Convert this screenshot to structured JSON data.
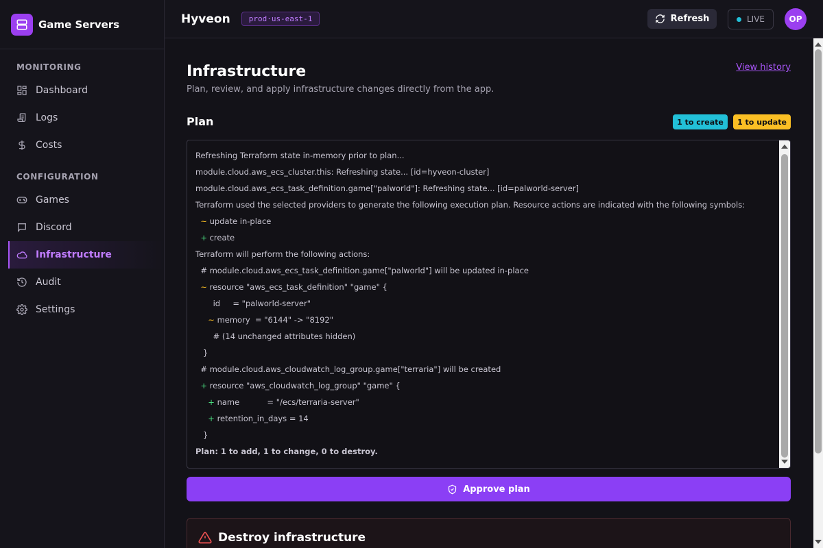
{
  "app": {
    "title": "Game Servers"
  },
  "sidebar": {
    "sections": [
      {
        "label": "MONITORING"
      },
      {
        "label": "CONFIGURATION"
      }
    ],
    "items": [
      {
        "label": "Dashboard",
        "icon": "dashboard-icon"
      },
      {
        "label": "Logs",
        "icon": "logs-icon"
      },
      {
        "label": "Costs",
        "icon": "dollar-icon"
      },
      {
        "label": "Games",
        "icon": "gamepad-icon"
      },
      {
        "label": "Discord",
        "icon": "chat-icon"
      },
      {
        "label": "Infrastructure",
        "icon": "cloud-icon",
        "active": true
      },
      {
        "label": "Audit",
        "icon": "history-icon"
      },
      {
        "label": "Settings",
        "icon": "gear-icon"
      }
    ]
  },
  "header": {
    "org": "Hyveon",
    "environment": "prod·us-east-1",
    "refresh_label": "Refresh",
    "live_label": "LIVE",
    "avatar_initials": "OP"
  },
  "page": {
    "title": "Infrastructure",
    "subtitle": "Plan, review, and apply infrastructure changes directly from the app.",
    "view_history": "View history"
  },
  "plan": {
    "title": "Plan",
    "badge_create": "1 to create",
    "badge_update": "1 to update",
    "lines": [
      {
        "sym": "",
        "text": "Refreshing Terraform state in-memory prior to plan..."
      },
      {
        "sym": "",
        "text": "module.cloud.aws_ecs_cluster.this: Refreshing state... [id=hyveon-cluster]"
      },
      {
        "sym": "",
        "text": "module.cloud.aws_ecs_task_definition.game[\"palworld\"]: Refreshing state... [id=palworld-server]"
      },
      {
        "sym": "",
        "text": "Terraform used the selected providers to generate the following execution plan. Resource actions are indicated with the following symbols:"
      },
      {
        "indent": "  ",
        "sym": "~",
        "text": " update in-place"
      },
      {
        "indent": "  ",
        "sym": "+",
        "text": " create"
      },
      {
        "sym": "",
        "text": "Terraform will perform the following actions:"
      },
      {
        "indent": "  ",
        "sym": "",
        "text": "# module.cloud.aws_ecs_task_definition.game[\"palworld\"] will be updated in-place"
      },
      {
        "indent": "  ",
        "sym": "~",
        "text": " resource \"aws_ecs_task_definition\" \"game\" {"
      },
      {
        "indent": "       ",
        "sym": "",
        "text": "id     = \"palworld-server\""
      },
      {
        "indent": "     ",
        "sym": "~",
        "text": " memory  = \"6144\" -> \"8192\""
      },
      {
        "indent": "       ",
        "sym": "",
        "text": "# (14 unchanged attributes hidden)"
      },
      {
        "indent": "   ",
        "sym": "",
        "text": "}"
      },
      {
        "indent": "  ",
        "sym": "",
        "text": "# module.cloud.aws_cloudwatch_log_group.game[\"terraria\"] will be created"
      },
      {
        "indent": "  ",
        "sym": "+",
        "text": " resource \"aws_cloudwatch_log_group\" \"game\" {"
      },
      {
        "indent": "     ",
        "sym": "+",
        "text": " name           = \"/ecs/terraria-server\""
      },
      {
        "indent": "     ",
        "sym": "+",
        "text": " retention_in_days = 14"
      },
      {
        "indent": "   ",
        "sym": "",
        "text": "}"
      },
      {
        "sym": "",
        "text": "Plan: 1 to add, 1 to change, 0 to destroy.",
        "bold": true
      }
    ]
  },
  "approve_label": "Approve plan",
  "destroy": {
    "title": "Destroy infrastructure"
  },
  "colors": {
    "accent": "#8b3ff5",
    "create": "#22c0d8",
    "update": "#fbbf24",
    "add_symbol": "#4ade80"
  }
}
